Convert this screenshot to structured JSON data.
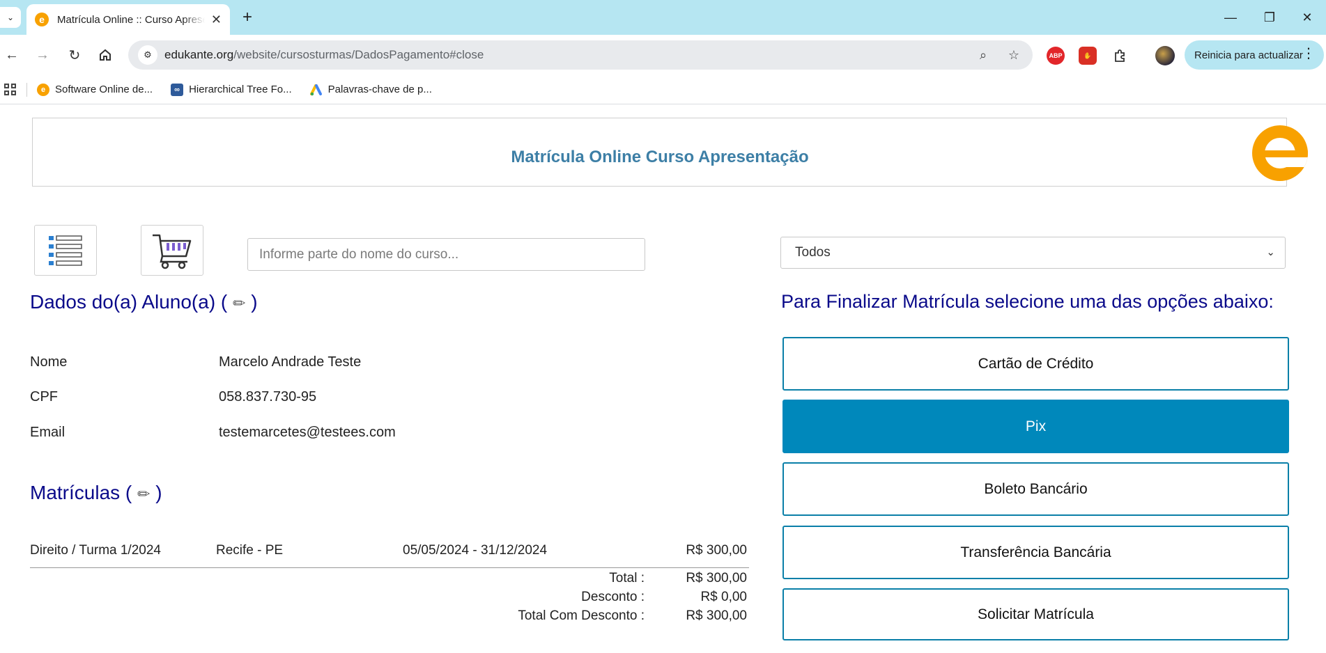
{
  "browser": {
    "tab_title": "Matrícula Online :: Curso Apresentação",
    "url_domain": "edukante.org",
    "url_path": "/website/cursosturmas/DadosPagamento#close",
    "update_label": "Reinicia para actualizar",
    "bookmarks": [
      {
        "label": "Software Online de..."
      },
      {
        "label": "Hierarchical Tree Fo..."
      },
      {
        "label": "Palavras-chave de p..."
      }
    ],
    "ext_abp": "ABP",
    "favicon_letter": "e"
  },
  "header": {
    "title": "Matrícula Online Curso Apresentação"
  },
  "search": {
    "placeholder": "Informe parte do nome do curso..."
  },
  "filter": {
    "selected": "Todos"
  },
  "student": {
    "section_title": "Dados do(a) Aluno(a) (",
    "section_close": ")",
    "fields": [
      {
        "label": "Nome",
        "value": "Marcelo Andrade Teste"
      },
      {
        "label": "CPF",
        "value": "058.837.730-95"
      },
      {
        "label": "Email",
        "value": "testemarcetes@testees.com"
      }
    ]
  },
  "enrollments": {
    "section_title": "Matrículas (",
    "section_close": ")",
    "rows": [
      {
        "course": "Direito / Turma 1/2024",
        "location": "Recife - PE",
        "period": "05/05/2024 - 31/12/2024",
        "price": "R$ 300,00"
      }
    ],
    "totals": [
      {
        "label": "Total :",
        "value": "R$ 300,00"
      },
      {
        "label": "Desconto :",
        "value": "R$ 0,00"
      },
      {
        "label": "Total Com Desconto :",
        "value": "R$ 300,00"
      }
    ]
  },
  "payment": {
    "section_title": "Para Finalizar Matrícula selecione uma das opções abaixo:",
    "options": [
      {
        "label": "Cartão de Crédito"
      },
      {
        "label": "Pix"
      },
      {
        "label": "Boleto Bancário"
      },
      {
        "label": "Transferência Bancária"
      },
      {
        "label": "Solicitar Matrícula"
      }
    ],
    "active_option": "Pix"
  },
  "colors": {
    "brand_orange": "#f8a100",
    "title_blue": "#3d7fa6",
    "section_navy": "#0a0a8a",
    "active_button": "#0088bb",
    "tabbar": "#b6e6f2"
  }
}
